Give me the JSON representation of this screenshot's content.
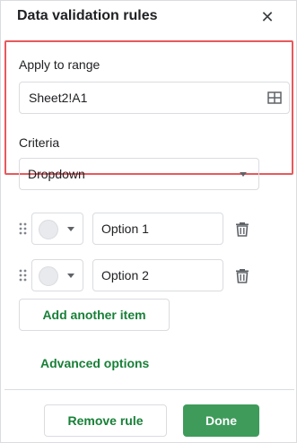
{
  "panel": {
    "title": "Data validation rules",
    "close_icon": "close-icon"
  },
  "range": {
    "label": "Apply to range",
    "value": "Sheet2!A1",
    "icon": "grid-select-icon"
  },
  "criteria": {
    "label": "Criteria",
    "selected": "Dropdown"
  },
  "options": [
    {
      "value": "Option 1"
    },
    {
      "value": "Option 2"
    }
  ],
  "actions": {
    "add_item": "Add another item",
    "advanced": "Advanced options",
    "remove": "Remove rule",
    "done": "Done"
  },
  "colors": {
    "accent": "#188038",
    "done_bg": "#3e9b5a",
    "highlight": "#e8595c",
    "border": "#dadce0"
  }
}
